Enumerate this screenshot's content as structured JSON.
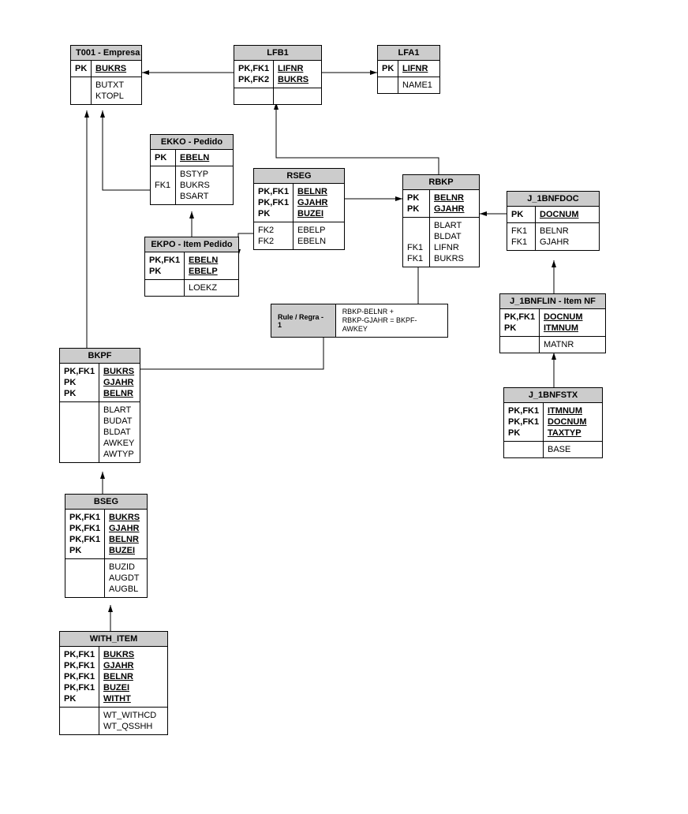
{
  "entities": {
    "t001": {
      "title": "T001 - Empresa",
      "keys1": [
        "PK"
      ],
      "pk1": [
        "BUKRS"
      ],
      "keys2": [
        ""
      ],
      "attrs2": [
        "BUTXT",
        "KTOPL"
      ]
    },
    "lfb1": {
      "title": "LFB1",
      "keys1": [
        "PK,FK1",
        "PK,FK2"
      ],
      "pk1": [
        "LIFNR",
        "BUKRS"
      ],
      "keys2": [],
      "attrs2": []
    },
    "lfa1": {
      "title": "LFA1",
      "keys1": [
        "PK"
      ],
      "pk1": [
        "LIFNR"
      ],
      "keys2": [
        ""
      ],
      "attrs2": [
        "NAME1"
      ]
    },
    "ekko": {
      "title": "EKKO - Pedido",
      "keys1": [
        "PK"
      ],
      "pk1": [
        "EBELN"
      ],
      "keys2": [
        "",
        "FK1",
        ""
      ],
      "attrs2": [
        "BSTYP",
        "BUKRS",
        "BSART"
      ]
    },
    "ekpo": {
      "title": "EKPO - Item Pedido",
      "keys1": [
        "PK,FK1",
        "PK"
      ],
      "pk1": [
        "EBELN",
        "EBELP"
      ],
      "keys2": [
        ""
      ],
      "attrs2": [
        "LOEKZ"
      ]
    },
    "rseg": {
      "title": "RSEG",
      "keys1": [
        "PK,FK1",
        "PK,FK1",
        "PK"
      ],
      "pk1": [
        "BELNR",
        "GJAHR",
        "BUZEI"
      ],
      "keys2": [
        "FK2",
        "FK2"
      ],
      "attrs2": [
        "EBELP",
        "EBELN"
      ]
    },
    "rbkp": {
      "title": "RBKP",
      "keys1": [
        "PK",
        "PK"
      ],
      "pk1": [
        "BELNR",
        "GJAHR"
      ],
      "keys2": [
        "",
        "",
        "FK1",
        "FK1"
      ],
      "attrs2": [
        "BLART",
        "BLDAT",
        "LIFNR",
        "BUKRS"
      ]
    },
    "j1bnfdoc": {
      "title": "J_1BNFDOC",
      "keys1": [
        "PK"
      ],
      "pk1": [
        "DOCNUM"
      ],
      "keys2": [
        "FK1",
        "FK1"
      ],
      "attrs2": [
        "BELNR",
        "GJAHR"
      ]
    },
    "j1bnflin": {
      "title": "J_1BNFLIN - Item NF",
      "keys1": [
        "PK,FK1",
        "PK"
      ],
      "pk1": [
        "DOCNUM",
        "ITMNUM"
      ],
      "keys2": [
        ""
      ],
      "attrs2": [
        "MATNR"
      ]
    },
    "j1bnfstx": {
      "title": "J_1BNFSTX",
      "keys1": [
        "PK,FK1",
        "PK,FK1",
        "PK"
      ],
      "pk1": [
        "ITMNUM",
        "DOCNUM",
        "TAXTYP"
      ],
      "keys2": [
        ""
      ],
      "attrs2": [
        "BASE"
      ]
    },
    "bkpf": {
      "title": "BKPF",
      "keys1": [
        "PK,FK1",
        "PK",
        "PK"
      ],
      "pk1": [
        "BUKRS",
        "GJAHR",
        "BELNR"
      ],
      "keys2": [
        "",
        "",
        "",
        "",
        ""
      ],
      "attrs2": [
        "BLART",
        "BUDAT",
        "BLDAT",
        "AWKEY",
        "AWTYP"
      ]
    },
    "bseg": {
      "title": "BSEG",
      "keys1": [
        "PK,FK1",
        "PK,FK1",
        "PK,FK1",
        "PK"
      ],
      "pk1": [
        "BUKRS",
        "GJAHR",
        "BELNR",
        "BUZEI"
      ],
      "keys2": [
        "",
        "",
        ""
      ],
      "attrs2": [
        "BUZID",
        "AUGDT",
        "AUGBL"
      ]
    },
    "with_item": {
      "title": "WITH_ITEM",
      "keys1": [
        "PK,FK1",
        "PK,FK1",
        "PK,FK1",
        "PK,FK1",
        "PK"
      ],
      "pk1": [
        "BUKRS",
        "GJAHR",
        "BELNR",
        "BUZEI",
        "WITHT"
      ],
      "keys2": [
        "",
        ""
      ],
      "attrs2": [
        "WT_WITHCD",
        "WT_QSSHH"
      ]
    }
  },
  "rule": {
    "title": "Rule / Regra - 1",
    "line1": "RBKP-BELNR +",
    "line2": "RBKP-GJAHR = BKPF-AWKEY"
  }
}
